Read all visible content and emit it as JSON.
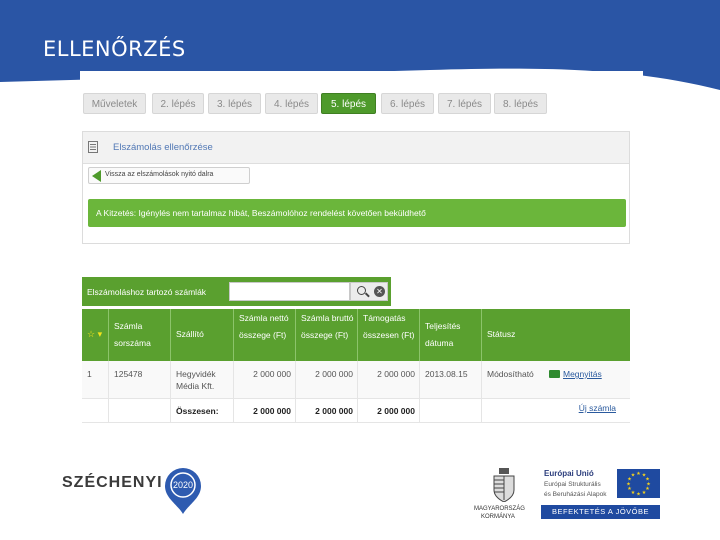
{
  "slide": {
    "title": "ELLENŐRZÉS"
  },
  "tabs": [
    {
      "label": "Műveletek"
    },
    {
      "label": "2. lépés"
    },
    {
      "label": "3. lépés"
    },
    {
      "label": "4. lépés"
    },
    {
      "label": "5. lépés",
      "active": true
    },
    {
      "label": "6. lépés"
    },
    {
      "label": "7. lépés"
    },
    {
      "label": "8. lépés"
    }
  ],
  "panel": {
    "title": "Elszámolás ellenőrzése",
    "back_label": "Vissza az elszámolások nyitó dalra",
    "success_message": "A Kitzetés: Igénylés nem tartalmaz hibát, Beszámolóhoz rendelést követően beküldhető"
  },
  "invoices": {
    "title": "Elszámoláshoz tartozó számlák",
    "search_value": "",
    "columns": {
      "sort": "☆ ▾",
      "number": "Számla sorszáma",
      "supplier": "Szállító",
      "net": "Számla nettó összege (Ft)",
      "gross": "Számla bruttó összege (Ft)",
      "support": "Támogatás összesen (Ft)",
      "date": "Teljesítés dátuma",
      "status": "Státusz"
    },
    "rows": [
      {
        "index": "1",
        "number": "125478",
        "supplier": "Hegyvidék Média Kft.",
        "net": "2 000 000",
        "gross": "2 000 000",
        "support": "2 000 000",
        "date": "2013.08.15",
        "status": "Módosítható",
        "action": "Megnyitás"
      }
    ],
    "totals": {
      "label": "Összesen:",
      "net": "2 000 000",
      "gross": "2 000 000",
      "support": "2 000 000",
      "action": "Új számla"
    }
  },
  "footer": {
    "szechenyi": "SZÉCHENYI",
    "szechenyi_year": "2020",
    "gov_line1": "MAGYARORSZÁG",
    "gov_line2": "KORMÁNYA",
    "eu_title": "Európai Unió",
    "eu_line1": "Európai Strukturális",
    "eu_line2": "és Beruházási Alapok",
    "eu_slogan": "BEFEKTETÉS A JÖVŐBE"
  },
  "colors": {
    "header_blue": "#2a55a5",
    "green": "#5aa02f",
    "link_blue": "#2a5a9e",
    "eu_blue": "#1f4aa0"
  }
}
